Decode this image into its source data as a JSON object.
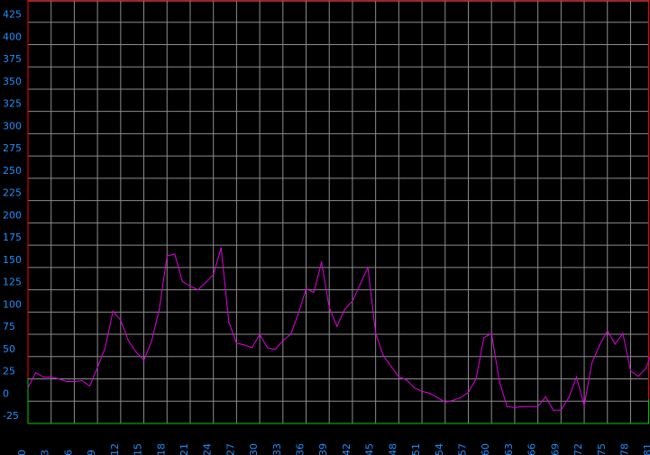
{
  "colors": {
    "background": "#000000",
    "grid": "#8c8c8c",
    "frame_top_right": "#ff0000",
    "frame_bottom": "#00cc00",
    "series": "#e000e0",
    "tick_label": "#1e90ff"
  },
  "chart_data": {
    "type": "line",
    "title": "",
    "xlabel": "",
    "ylabel": "",
    "xlim": [
      0,
      82.5
    ],
    "ylim": [
      -25,
      450
    ],
    "grid": true,
    "legend": "none",
    "y_ticks": [
      -25,
      0,
      25,
      50,
      75,
      100,
      125,
      150,
      175,
      200,
      225,
      250,
      275,
      300,
      325,
      350,
      375,
      400,
      425
    ],
    "x_ticks": [
      0,
      3,
      6,
      9,
      12,
      15,
      18,
      21,
      24,
      27,
      30,
      33,
      36,
      39,
      42,
      45,
      48,
      51,
      54,
      57,
      60,
      63,
      66,
      69,
      72,
      75,
      78,
      81
    ],
    "series": [
      {
        "x": [
          0,
          1,
          2,
          3,
          4,
          5,
          6,
          7,
          8,
          9,
          10,
          11,
          12,
          13,
          14,
          15,
          16,
          17,
          18,
          19,
          20,
          21,
          22,
          23,
          24,
          25,
          26,
          27,
          28,
          29,
          30,
          31,
          32,
          33,
          34,
          35,
          36,
          37,
          38,
          39,
          40,
          41,
          42,
          43,
          44,
          45,
          46,
          47,
          48,
          49,
          50,
          51,
          52,
          53,
          54,
          55,
          56,
          57,
          58,
          59,
          60,
          61,
          62,
          63,
          64,
          65,
          66,
          67,
          68,
          69,
          70,
          71,
          72,
          73,
          74,
          75,
          76,
          77,
          78,
          79,
          80,
          81,
          82,
          83
        ],
        "values": [
          15,
          32,
          27,
          27,
          25,
          22,
          22,
          23,
          17,
          38,
          60,
          101,
          91,
          68,
          55,
          46,
          67,
          103,
          163,
          165,
          134,
          129,
          125,
          133,
          142,
          172,
          89,
          65,
          63,
          60,
          75,
          60,
          58,
          68,
          75,
          98,
          126,
          122,
          156,
          105,
          84,
          103,
          112,
          131,
          150,
          76,
          51,
          39,
          27,
          24,
          15,
          11,
          9,
          4,
          -1,
          1,
          4,
          10,
          25,
          71,
          76,
          23,
          -6,
          -7,
          -6,
          -6,
          -6,
          5,
          -10,
          -10,
          4,
          27,
          -5,
          43,
          63,
          79,
          64,
          76,
          34,
          28,
          37,
          61,
          26,
          0
        ]
      }
    ]
  }
}
